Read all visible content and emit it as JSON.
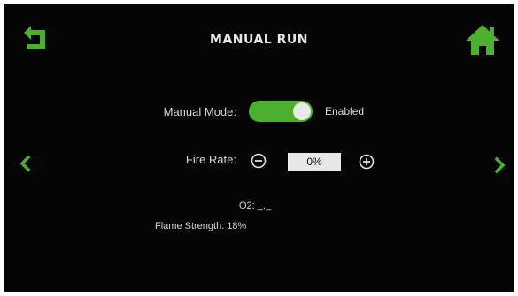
{
  "header": {
    "title": "MANUAL RUN"
  },
  "manual_mode": {
    "label": "Manual Mode:",
    "enabled": true,
    "status_text": "Enabled"
  },
  "fire_rate": {
    "label": "Fire Rate:",
    "value": "0%"
  },
  "o2": {
    "label": "O2:",
    "value": "_._"
  },
  "flame_strength": {
    "text": "Flame Strength: 18%"
  },
  "colors": {
    "accent": "#4caf2e",
    "background": "#050505",
    "text": "#d9d9d9"
  },
  "icons": {
    "back": "back-arrow-icon",
    "home": "home-icon",
    "prev": "chevron-left-icon",
    "next": "chevron-right-icon",
    "decrease": "minus-circle-icon",
    "increase": "plus-circle-icon"
  }
}
